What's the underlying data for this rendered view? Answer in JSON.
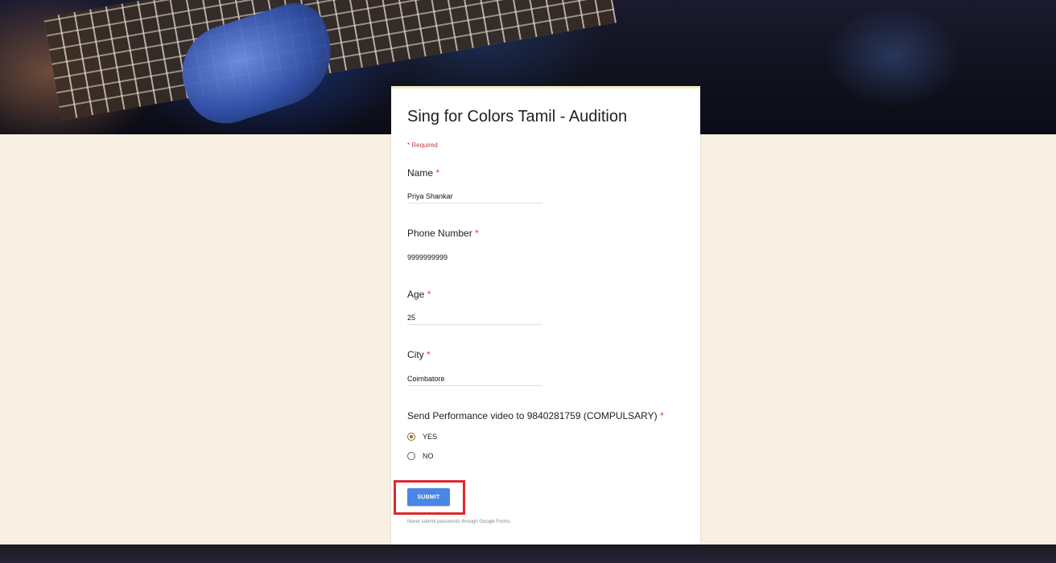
{
  "form": {
    "title": "Sing for Colors Tamil - Audition",
    "required_note": "* Required",
    "asterisk": "*",
    "questions": {
      "name": {
        "label": "Name",
        "value": "Priya Shankar"
      },
      "phone": {
        "label": "Phone Number",
        "value": "9999999999"
      },
      "age": {
        "label": "Age",
        "value": "25"
      },
      "city": {
        "label": "City",
        "value": "Coimbatore"
      },
      "video": {
        "label": "Send Performance video to 9840281759 (COMPULSARY)",
        "options": [
          "YES",
          "NO"
        ],
        "selected": "YES"
      }
    },
    "submit_label": "SUBMIT",
    "footer_note": "Never submit passwords through Google Forms."
  },
  "colors": {
    "page_background": "#f8f1e3",
    "submit_button": "#4a86e8",
    "required_asterisk": "#db4437",
    "highlight_box": "#e0272f",
    "radio_selected": "#8a6d1f"
  }
}
